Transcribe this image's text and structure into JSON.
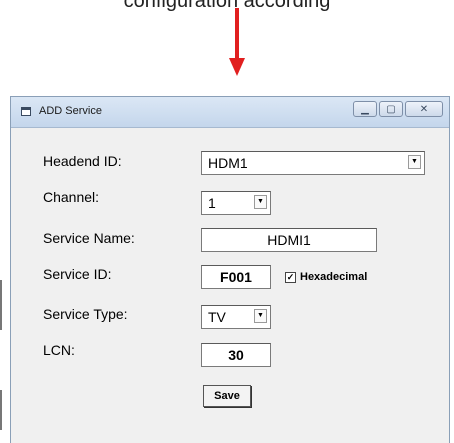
{
  "caption": "configuration according",
  "window": {
    "title": "ADD Service",
    "buttons": [
      "minimize",
      "maximize",
      "close"
    ]
  },
  "form": {
    "headend_id": {
      "label": "Headend ID:",
      "value": "HDM1"
    },
    "channel": {
      "label": "Channel:",
      "value": "1"
    },
    "service_name": {
      "label": "Service Name:",
      "value": "HDMI1"
    },
    "service_id": {
      "label": "Service ID:",
      "value": "F001",
      "checkbox_label": "Hexadecimal",
      "checkbox_checked": true
    },
    "service_type": {
      "label": "Service Type:",
      "value": "TV"
    },
    "lcn": {
      "label": "LCN:",
      "value": "30"
    },
    "save_label": "Save"
  },
  "colors": {
    "arrow": "#e11f1f"
  }
}
